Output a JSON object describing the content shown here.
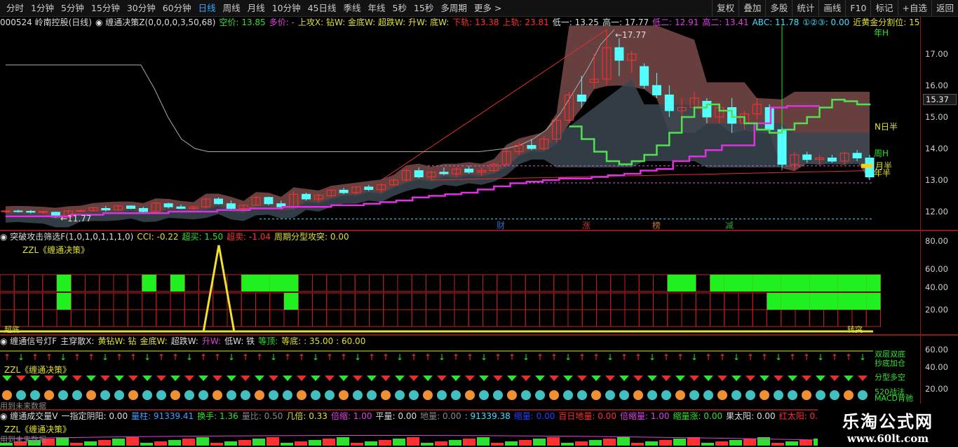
{
  "toolbar": {
    "periods": [
      "分时",
      "1分钟",
      "5分钟",
      "15分钟",
      "30分钟",
      "60分钟",
      "日线",
      "周线",
      "月线",
      "10分钟",
      "45日线",
      "季线",
      "年线",
      "5秒",
      "15秒",
      "多周期",
      "更多 >"
    ],
    "active_period": "日线",
    "tools": [
      "复权",
      "叠加",
      "多股",
      "统计",
      "画线",
      "F10",
      "标记",
      "+自选",
      "返回"
    ]
  },
  "main": {
    "header": [
      {
        "t": "000524 岭南控股(日线)",
        "c": "#dddddd"
      },
      {
        "t": "◉ 缠通决策Z(0,0,0,0,3,50,68)",
        "c": "#dddddd"
      },
      {
        "t": "空价: 13.85",
        "c": "#30e030"
      },
      {
        "t": "多价: -",
        "c": "#e040e0"
      },
      {
        "t": "上攻X: 钻W: 金底W: 超跌W: 升W: 底W:",
        "c": "#e0e030"
      },
      {
        "t": "下轨: 13.38",
        "c": "#ff3030"
      },
      {
        "t": "上轨: 23.81",
        "c": "#ff3030"
      },
      {
        "t": "低一: 13.25",
        "c": "#dddddd"
      },
      {
        "t": "高一: 17.77",
        "c": "#dddddd"
      },
      {
        "t": "低二: 12.91",
        "c": "#e040e0"
      },
      {
        "t": "高二: 13.41",
        "c": "#e040e0"
      },
      {
        "t": "ABC: 11.78",
        "c": "#40e0ff"
      },
      {
        "t": "①②③: 0.00",
        "c": "#40e0ff"
      },
      {
        "t": "近黄金分割位: 15.51",
        "c": "#e0e030"
      }
    ],
    "price_ticks": [
      "17.00",
      "16.00",
      "15.00",
      "14.00",
      "13.00",
      "12.00"
    ],
    "current_price": "15.37",
    "high_label": "←17.77",
    "low_label": "←11.77",
    "right_labels": [
      {
        "t": "N日半",
        "c": "#e0e030"
      },
      {
        "t": "周H",
        "c": "#30e030"
      },
      {
        "t": "月半",
        "c": "#e0e030"
      },
      {
        "t": "年半",
        "c": "#e0e030"
      },
      {
        "t": "年H",
        "c": "#30e030"
      }
    ],
    "markers": [
      {
        "t": "财",
        "c": "#1e6fd0"
      },
      {
        "t": "涨",
        "c": "#c0303a"
      },
      {
        "t": "榜",
        "c": "#c87830"
      },
      {
        "t": "减",
        "c": "#30a040"
      }
    ]
  },
  "pane2": {
    "header": [
      {
        "t": "◉ 突破攻击筛选F(1,0,1,0,1,1,1,0)",
        "c": "#dddddd"
      },
      {
        "t": "CCI: -0.22",
        "c": "#e0e030"
      },
      {
        "t": "超买: 1.50",
        "c": "#30e030"
      },
      {
        "t": "超卖: -1.04",
        "c": "#ff3030"
      },
      {
        "t": "周期分型攻突: 0.00",
        "c": "#e0e030"
      }
    ],
    "subtitle": "ZZL《缠通决策》",
    "ticks": [
      "80.00",
      "60.00",
      "40.00",
      "20.00"
    ],
    "bottom_left": "超底",
    "bottom_right": "转突"
  },
  "pane3": {
    "header": [
      {
        "t": "◉ 缠通信号灯F",
        "c": "#dddddd"
      },
      {
        "t": "主穿散X:",
        "c": "#dddddd"
      },
      {
        "t": "黄钻W: 钻",
        "c": "#e0e030"
      },
      {
        "t": "金底W:",
        "c": "#e0e030"
      },
      {
        "t": "超跌W:",
        "c": "#dddddd"
      },
      {
        "t": "升W:",
        "c": "#e040e0"
      },
      {
        "t": "低W: 铁",
        "c": "#dddddd"
      },
      {
        "t": "等顶:",
        "c": "#30e030"
      },
      {
        "t": "等底: : 35.00 : 60.00",
        "c": "#e0e030"
      }
    ],
    "subtitle": "ZZL《缠通决策》",
    "ticks": [
      "60.00",
      "40.00",
      "20.00"
    ],
    "legend": [
      "双层双底",
      "抄底加仓",
      "分型多空",
      "520战法",
      "MACD背驰"
    ],
    "bottom_left": "用到未来数据"
  },
  "pane4": {
    "header": [
      {
        "t": "◉ 缠通成交量V",
        "c": "#dddddd"
      },
      {
        "t": "一指定阴阳: 0.00",
        "c": "#dddddd"
      },
      {
        "t": "量柱: 91339.41",
        "c": "#40a0ff"
      },
      {
        "t": "换手: 1.36",
        "c": "#30e030"
      },
      {
        "t": "量比: 0.50",
        "c": "#888888"
      },
      {
        "t": "几倍: 0.33",
        "c": "#e0e030"
      },
      {
        "t": "倍缩: 1.00",
        "c": "#e040e0"
      },
      {
        "t": "平量: 0.00",
        "c": "#dddddd"
      },
      {
        "t": "地量: 0.00",
        "c": "#888888"
      },
      {
        "t": ": 91339.38",
        "c": "#40e0ff"
      },
      {
        "t": "缩量: 0.00",
        "c": "#2040ff"
      },
      {
        "t": "百日地量: 0.00",
        "c": "#ff3030"
      },
      {
        "t": "倍缩量: 1.00",
        "c": "#e040e0"
      },
      {
        "t": "缩量涨: 0.00",
        "c": "#30e030"
      },
      {
        "t": "果太阳: 0.00",
        "c": "#dddddd"
      },
      {
        "t": "红太阳: 0.00",
        "c": "#ff3030"
      },
      {
        "t": "吸: - 拉: -",
        "c": "#e040e0"
      }
    ],
    "subtitle": "ZZL《缠通决策》",
    "bottom_left": "用到未来数据"
  },
  "logo": {
    "name": "乐淘公式网",
    "url": "www.60lt.com"
  },
  "colors": {
    "up": "#ff3030",
    "down": "#54ffff",
    "accent": "#3fa7ff"
  },
  "chart_data": {
    "type": "candlestick",
    "series": [
      {
        "name": "K线",
        "ohlc": [
          [
            12.0,
            12.05,
            11.95,
            12.02
          ],
          [
            12.02,
            12.06,
            11.97,
            12.01
          ],
          [
            12.01,
            12.05,
            11.94,
            11.98
          ],
          [
            11.98,
            12.03,
            11.92,
            12.0
          ],
          [
            11.98,
            12.0,
            11.8,
            11.83
          ],
          [
            11.83,
            12.05,
            11.8,
            12.02
          ],
          [
            12.02,
            12.07,
            11.98,
            12.03
          ],
          [
            12.03,
            12.15,
            12.0,
            12.12
          ],
          [
            12.1,
            12.18,
            12.0,
            12.05
          ],
          [
            12.05,
            12.2,
            12.02,
            12.18
          ],
          [
            12.18,
            12.2,
            12.08,
            12.1
          ],
          [
            12.1,
            12.15,
            11.97,
            12.0
          ],
          [
            12.0,
            12.3,
            11.98,
            12.27
          ],
          [
            12.25,
            12.28,
            12.1,
            12.15
          ],
          [
            12.15,
            12.22,
            12.08,
            12.1
          ],
          [
            12.1,
            12.18,
            12.05,
            12.15
          ],
          [
            12.15,
            12.45,
            12.1,
            12.4
          ],
          [
            12.4,
            12.45,
            12.22,
            12.25
          ],
          [
            12.25,
            12.35,
            12.05,
            12.1
          ],
          [
            12.1,
            12.22,
            12.0,
            12.2
          ],
          [
            12.2,
            12.5,
            12.18,
            12.45
          ],
          [
            12.45,
            12.48,
            12.2,
            12.25
          ],
          [
            12.25,
            12.35,
            12.08,
            12.15
          ],
          [
            12.15,
            12.65,
            12.1,
            12.55
          ],
          [
            12.55,
            12.6,
            12.35,
            12.4
          ],
          [
            12.4,
            12.55,
            12.3,
            12.52
          ],
          [
            12.5,
            12.7,
            12.45,
            12.68
          ],
          [
            12.68,
            12.75,
            12.55,
            12.6
          ],
          [
            12.6,
            12.8,
            12.55,
            12.78
          ],
          [
            12.78,
            12.85,
            12.65,
            12.7
          ],
          [
            12.7,
            12.9,
            12.6,
            12.85
          ],
          [
            12.85,
            13.05,
            12.8,
            13.0
          ],
          [
            13.0,
            13.35,
            12.95,
            13.3
          ],
          [
            13.3,
            13.4,
            13.05,
            13.1
          ],
          [
            13.1,
            13.3,
            13.0,
            13.25
          ],
          [
            13.25,
            13.4,
            13.15,
            13.2
          ],
          [
            13.2,
            13.4,
            13.1,
            13.35
          ],
          [
            13.35,
            13.45,
            13.2,
            13.25
          ],
          [
            13.25,
            13.4,
            13.15,
            13.3
          ],
          [
            13.3,
            13.55,
            13.25,
            13.5
          ],
          [
            13.5,
            14.0,
            13.45,
            13.9
          ],
          [
            13.9,
            14.2,
            13.8,
            14.1
          ],
          [
            14.1,
            14.3,
            13.95,
            14.0
          ],
          [
            14.0,
            14.4,
            13.95,
            14.3
          ],
          [
            14.3,
            15.0,
            14.2,
            14.9
          ],
          [
            14.9,
            15.8,
            14.8,
            15.7
          ],
          [
            15.7,
            16.3,
            15.3,
            15.5
          ],
          [
            16.1,
            17.0,
            15.9,
            16.2
          ],
          [
            16.2,
            17.77,
            16.0,
            17.2
          ],
          [
            17.2,
            17.5,
            16.3,
            16.8
          ],
          [
            16.8,
            17.1,
            16.4,
            17.0
          ],
          [
            16.6,
            16.7,
            15.9,
            16.0
          ],
          [
            16.0,
            16.4,
            15.6,
            15.7
          ],
          [
            15.7,
            16.0,
            15.0,
            15.2
          ],
          [
            15.2,
            15.6,
            14.9,
            15.3
          ],
          [
            15.3,
            15.8,
            15.1,
            15.6
          ],
          [
            15.5,
            15.6,
            14.8,
            15.0
          ],
          [
            15.0,
            15.4,
            14.8,
            15.3
          ],
          [
            15.3,
            15.6,
            14.5,
            14.8
          ],
          [
            14.8,
            15.2,
            14.6,
            15.1
          ],
          [
            15.1,
            15.6,
            14.9,
            15.4
          ],
          [
            15.3,
            15.4,
            14.5,
            14.6
          ],
          [
            14.6,
            14.7,
            13.4,
            13.5
          ],
          [
            13.5,
            13.9,
            13.3,
            13.8
          ],
          [
            13.8,
            13.9,
            13.55,
            13.65
          ],
          [
            13.65,
            13.8,
            13.5,
            13.7
          ],
          [
            13.7,
            13.8,
            13.55,
            13.6
          ],
          [
            13.6,
            13.9,
            13.5,
            13.85
          ],
          [
            13.85,
            13.95,
            13.6,
            13.7
          ],
          [
            13.7,
            13.8,
            13.0,
            13.1
          ]
        ]
      },
      {
        "name": "中轨",
        "values": [
          14.7,
          14.3,
          13.9,
          13.6,
          13.5,
          13.6,
          13.8,
          14.1,
          14.5,
          15.0,
          15.3,
          15.4,
          15.2,
          15.0,
          14.8,
          14.6,
          14.5,
          14.6,
          14.8,
          15.0,
          15.3,
          15.55,
          15.5,
          15.4,
          15.37
        ]
      },
      {
        "name": "灰线",
        "values": [
          16.65,
          16.65,
          16.65,
          16.65,
          16.65,
          16.65,
          16.65,
          16.65,
          16.65,
          16.65,
          16.65,
          15.9,
          15.0,
          14.3,
          14.0,
          13.9,
          13.9,
          13.9,
          13.9,
          13.9,
          13.9,
          13.9,
          13.9,
          13.9,
          13.9,
          13.9,
          13.9,
          13.9,
          13.9,
          13.9,
          13.9,
          13.9,
          13.9,
          13.9,
          13.9,
          13.9,
          13.95,
          14.0,
          14.1,
          14.3,
          14.6,
          15.1,
          15.8,
          16.5,
          17.3,
          17.77
        ]
      },
      {
        "name": "紫线",
        "values": [
          11.85,
          11.85,
          11.85,
          11.85,
          11.9,
          11.9,
          11.95,
          11.95,
          11.95,
          11.95,
          12.0,
          12.0,
          12.0,
          12.05,
          12.05,
          12.1,
          12.1,
          12.15,
          12.15,
          12.15,
          12.2,
          12.2,
          12.25,
          12.3,
          12.35,
          12.45,
          12.5,
          12.55,
          12.6,
          12.7,
          12.8,
          12.9,
          12.95,
          13.0,
          13.05,
          13.05,
          13.1,
          13.15,
          13.2,
          13.3,
          13.35,
          13.6,
          13.75,
          13.95,
          14.1,
          14.1,
          14.8,
          15.3,
          15.35,
          15.35,
          15.35
        ]
      }
    ],
    "ylim": [
      11.6,
      18.0
    ]
  }
}
